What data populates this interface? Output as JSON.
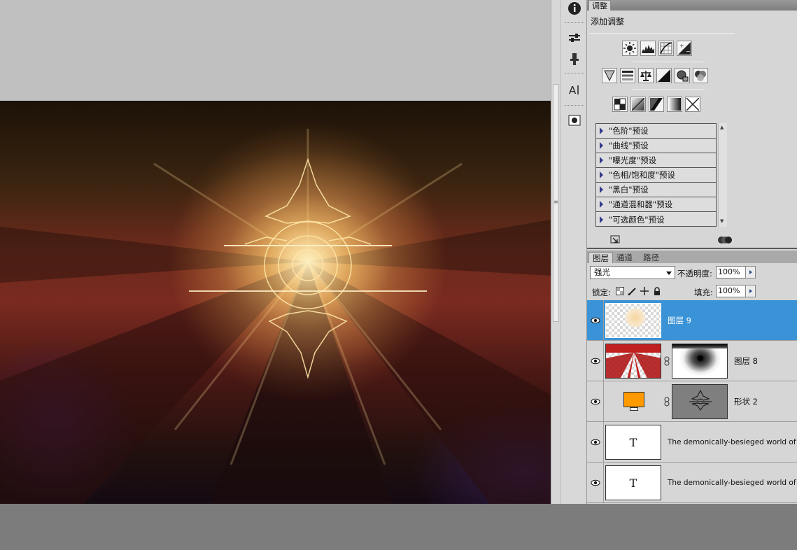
{
  "adjustments_panel": {
    "tab_label": "调整",
    "heading": "添加调整",
    "row1_icons": [
      "brightness-icon",
      "levels-icon",
      "curves-icon",
      "exposure-icon"
    ],
    "row2_icons": [
      "vibrance-icon",
      "hue-saturation-icon",
      "color-balance-icon",
      "black-white-icon",
      "photo-filter-icon",
      "channel-mixer-icon"
    ],
    "row3_icons": [
      "invert-icon",
      "posterize-icon",
      "threshold-icon",
      "gradient-map-icon",
      "selective-color-icon"
    ],
    "presets": [
      "\"色阶\"预设",
      "\"曲线\"预设",
      "\"曝光度\"预设",
      "\"色相/饱和度\"预设",
      "\"黑白\"预设",
      "\"通道混和器\"预设",
      "\"可选颜色\"预设"
    ]
  },
  "layers_panel": {
    "tabs": [
      "图层",
      "通道",
      "路径"
    ],
    "active_tab": "图层",
    "blend_mode": "强光",
    "opacity_label": "不透明度:",
    "opacity_value": "100%",
    "lock_label": "锁定:",
    "fill_label": "填充:",
    "fill_value": "100%",
    "layers": [
      {
        "name": "图层 9",
        "selected": true,
        "thumb": "transparent-glow",
        "mask": false
      },
      {
        "name": "图层 8",
        "selected": false,
        "thumb": "red-rays",
        "mask": true
      },
      {
        "name": "形状 2",
        "selected": false,
        "thumb": "orange-fill",
        "mask": true
      },
      {
        "name": "The demonically-besieged world of  副本",
        "selected": false,
        "thumb": "text",
        "mask": false
      },
      {
        "name": "The demonically-besieged world of  副本",
        "selected": false,
        "thumb": "text",
        "mask": false
      }
    ],
    "text_thumb_glyph": "T"
  },
  "colors": {
    "selection_blue": "#3a93d6",
    "panel_gray": "#d6d6d6",
    "shape_fill": "#ff9900"
  }
}
